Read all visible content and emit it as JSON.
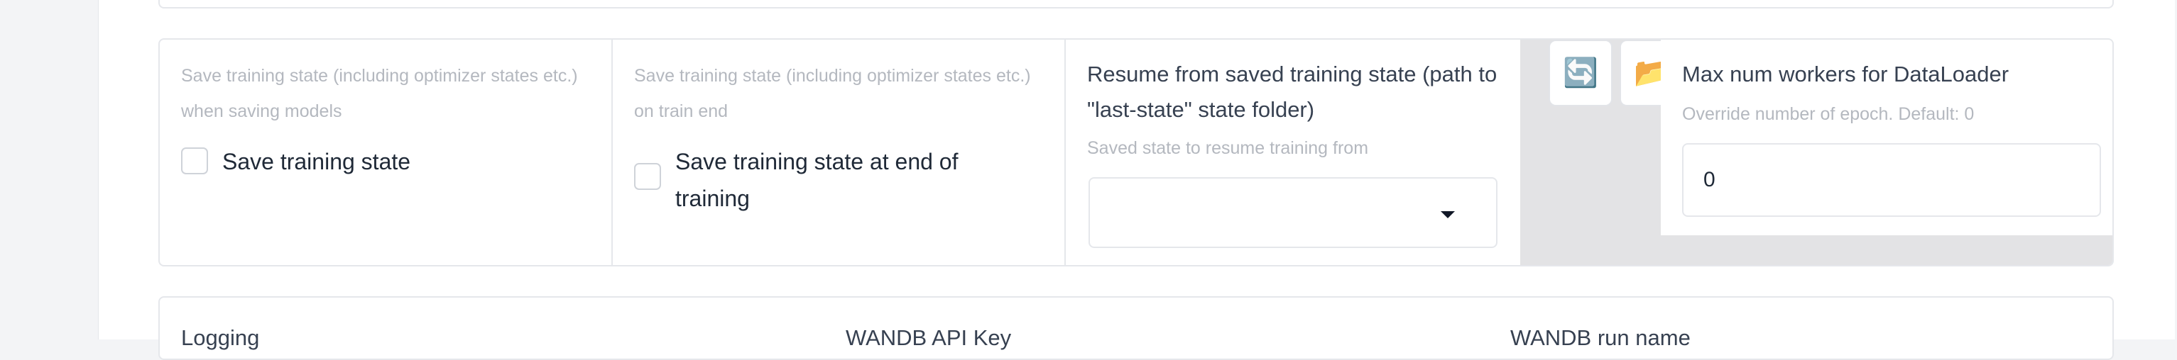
{
  "training_state": {
    "save_state": {
      "info": "Save training state (including optimizer states etc.) when saving models",
      "label": "Save training state",
      "checked": false
    },
    "save_state_on_end": {
      "info": "Save training state (including optimizer states etc.) on train end",
      "label": "Save training state at end of training",
      "checked": false
    },
    "resume": {
      "label": "Resume from saved training state (path to \"last-state\" state folder)",
      "info": "Saved state to resume training from",
      "value": ""
    },
    "buttons": {
      "refresh_icon": "🔄",
      "folder_icon": "📂"
    },
    "max_workers": {
      "label": "Max num workers for DataLoader",
      "info": "Override number of epoch. Default: 0",
      "value": "0"
    }
  },
  "logging": {
    "logging_label": "Logging",
    "wandb_api_key_label": "WANDB API Key",
    "wandb_run_name_label": "WANDB run name"
  }
}
